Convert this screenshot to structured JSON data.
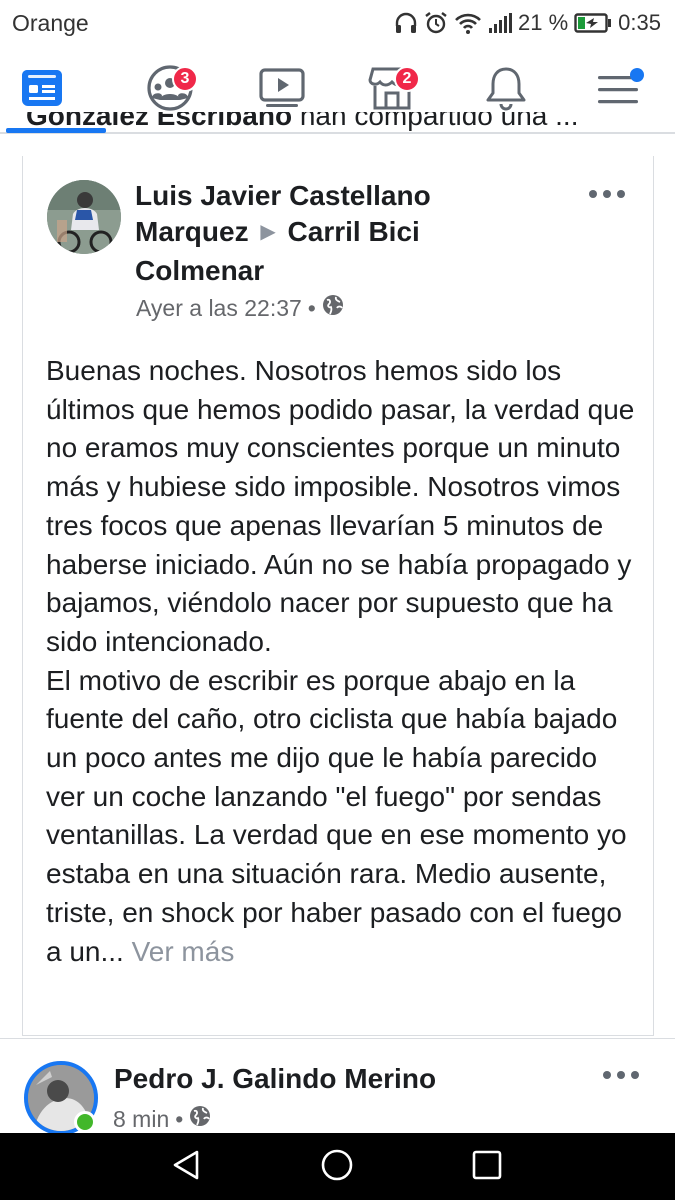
{
  "status_bar": {
    "carrier": "Orange",
    "battery_percent": "21 %",
    "time": "0:35",
    "icons": [
      "headphones-icon",
      "alarm-icon",
      "wifi-icon",
      "signal-icon",
      "battery-charging-icon"
    ]
  },
  "nav": {
    "items": [
      {
        "name": "news-feed",
        "icon": "feed-icon",
        "active": true
      },
      {
        "name": "groups",
        "icon": "groups-icon",
        "badge": "3"
      },
      {
        "name": "watch",
        "icon": "video-icon"
      },
      {
        "name": "marketplace",
        "icon": "store-icon",
        "badge": "2"
      },
      {
        "name": "notifications",
        "icon": "bell-icon"
      },
      {
        "name": "menu",
        "icon": "hamburger-icon",
        "dot": true
      }
    ]
  },
  "partial_line": {
    "bold": "González Escribano",
    "rest": " han compartido una ..."
  },
  "post": {
    "author": "Luis Javier Castellano Marquez",
    "target": "Carril Bici Colmenar",
    "timestamp": "Ayer a las 22:37",
    "separator": "•",
    "paragraph1": "Buenas noches. Nosotros hemos sido los últimos que hemos podido pasar, la verdad que no eramos muy conscientes porque un minuto más y hubiese sido imposible. Nosotros vimos tres focos que apenas llevarían 5 minutos de haberse iniciado. Aún no se había propagado y bajamos, viéndolo nacer por supuesto que ha sido intencionado.",
    "paragraph2": "El motivo de escribir es porque abajo en la fuente del caño, otro ciclista que había bajado un poco antes me dijo que le había parecido ver un coche lanzando \"el fuego\" por sendas ventanillas. La verdad que en ese momento yo estaba en una situación rara. Medio ausente, triste, en shock por haber pasado con el fuego a un...",
    "see_more": "Ver más"
  },
  "post2": {
    "author": "Pedro J. Galindo Merino",
    "timestamp": "8 min",
    "separator": "•"
  },
  "colors": {
    "accent": "#1877f2",
    "badge": "#f02849",
    "online": "#42b72a"
  }
}
